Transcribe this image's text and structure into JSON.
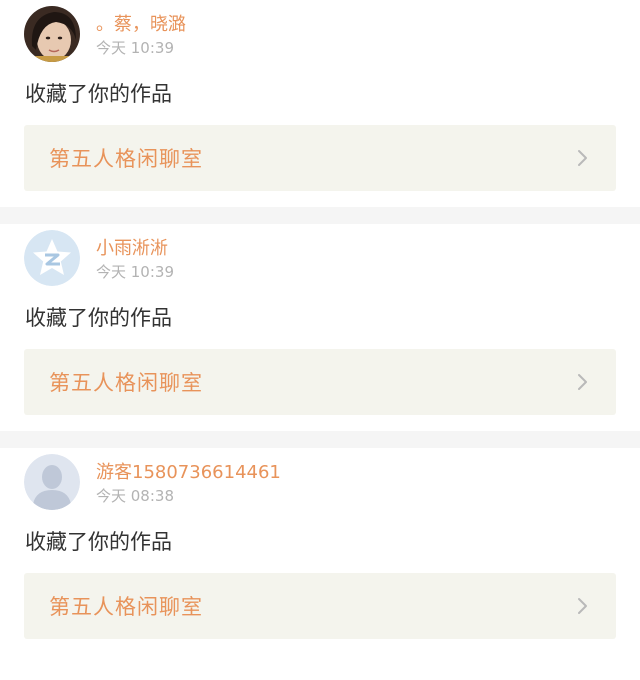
{
  "notifications": [
    {
      "user_name": "。蔡，晓潞",
      "time": "今天 10:39",
      "action": "收藏了你的作品",
      "work_title": "第五人格闲聊室",
      "avatar_icon": "photo-avatar"
    },
    {
      "user_name": "小雨淅淅",
      "time": "今天 10:39",
      "action": "收藏了你的作品",
      "work_title": "第五人格闲聊室",
      "avatar_icon": "qzone-star-avatar"
    },
    {
      "user_name": "游客1580736614461",
      "time": "今天 08:38",
      "action": "收藏了你的作品",
      "work_title": "第五人格闲聊室",
      "avatar_icon": "default-person-avatar"
    }
  ],
  "colors": {
    "accent": "#e8935a",
    "time": "#b3b3b3",
    "text": "#333333",
    "work_bg": "#f4f4ed",
    "separator": "#f5f5f5"
  }
}
